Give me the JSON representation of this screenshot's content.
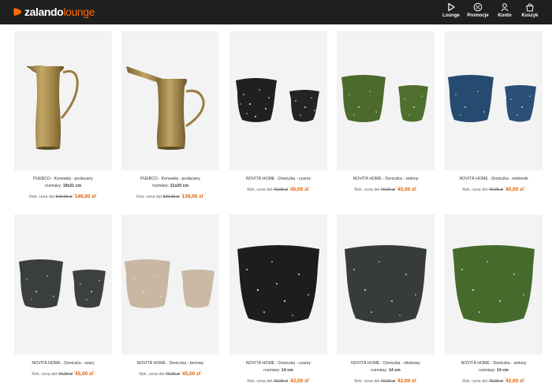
{
  "brand": {
    "name_part1": "zalando",
    "name_part2": "lounge"
  },
  "nav": [
    {
      "id": "lounge",
      "label": "Lounge",
      "icon": "lounge-icon"
    },
    {
      "id": "promocje",
      "label": "Promocje",
      "icon": "promo-icon"
    },
    {
      "id": "konto",
      "label": "Konto",
      "icon": "account-icon"
    },
    {
      "id": "koszyk",
      "label": "Koszyk",
      "icon": "cart-icon"
    }
  ],
  "colors": {
    "header": "#1f1f1f",
    "accent": "#ff6900",
    "price": "#e35b00",
    "card_bg": "#f3f3f3"
  },
  "products": [
    {
      "title": "PUEBCO - Konewka - pozłacany",
      "size_label": "rozmiary:",
      "size": "19x21 cm",
      "rec_label": "Rek. cena det",
      "old_price": "540,00 zł",
      "price": "149,00 zł",
      "marker": "*",
      "image": "brass-jug"
    },
    {
      "title": "PUEBCO - Konewka - pozłacany",
      "size_label": "rozmiary:",
      "size": "21x20 cm",
      "rec_label": "Rek. cena det",
      "old_price": "520,00 zł",
      "price": "139,00 zł",
      "marker": "*",
      "image": "brass-watering-can"
    },
    {
      "title": "NOVITÀ HOME - Doniczka - czarny",
      "rec_label": "Rek. cena det",
      "old_price": "70,00 zł",
      "price": "45,00 zł",
      "marker": "*",
      "image": "pots-black"
    },
    {
      "title": "NOVITÀ HOME - Doniczka - zielony",
      "rec_label": "Rek. cena det",
      "old_price": "70,00 zł",
      "price": "45,00 zł",
      "marker": "*",
      "image": "pots-green"
    },
    {
      "title": "NOVITÀ HOME - Doniczka - niebieski",
      "rec_label": "Rek. cena det",
      "old_price": "70,00 zł",
      "price": "45,00 zł",
      "marker": "*",
      "image": "pots-blue"
    },
    {
      "title": "NOVITÀ HOME - Doniczka - szary",
      "rec_label": "Rek. cena det",
      "old_price": "70,00 zł",
      "price": "45,00 zł",
      "marker": "*",
      "image": "pots-grey"
    },
    {
      "title": "NOVITÀ HOME - Doniczka - beżowy",
      "rec_label": "Rek. cena det",
      "old_price": "70,00 zł",
      "price": "45,00 zł",
      "marker": "*",
      "image": "pots-beige"
    },
    {
      "title": "NOVITÀ HOME - Doniczka - czarny",
      "size_label": "rozmiary:",
      "size": "14 cm",
      "rec_label": "Rek. cena det",
      "old_price": "70,00 zł",
      "price": "42,00 zł",
      "marker": "*",
      "image": "pot-black-large"
    },
    {
      "title": "NOVITÀ HOME - Doniczka - oliwkowy",
      "size_label": "rozmiary:",
      "size": "14 cm",
      "rec_label": "Rek. cena det",
      "old_price": "70,00 zł",
      "price": "42,00 zł",
      "marker": "*",
      "image": "pot-olive-large"
    },
    {
      "title": "NOVITÀ HOME - Doniczka - zielony",
      "size_label": "rozmiary:",
      "size": "14 cm",
      "rec_label": "Rek. cena det",
      "old_price": "70,00 zł",
      "price": "42,00 zł",
      "marker": "*",
      "image": "pot-green-large"
    }
  ]
}
